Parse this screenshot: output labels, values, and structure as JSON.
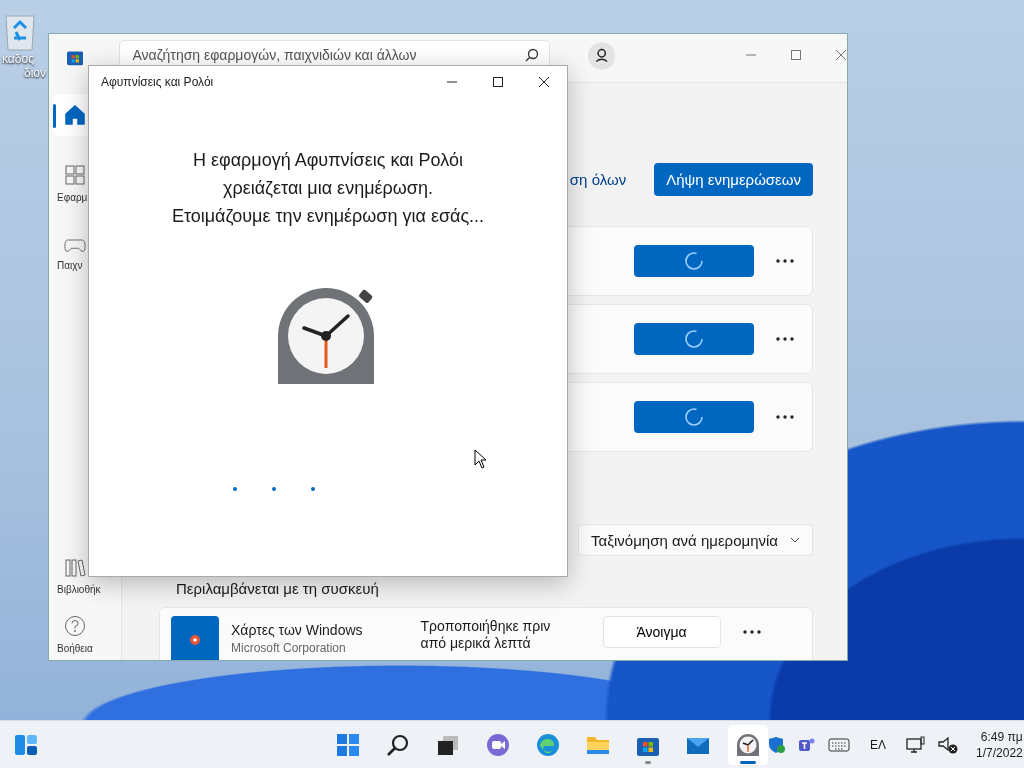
{
  "desktop": {
    "icons": [
      {
        "kind": "recycle-bin",
        "label_lines": [
          "καδος",
          "διον"
        ]
      }
    ]
  },
  "store": {
    "search": {
      "placeholder": "Αναζήτηση εφαρμογών, παιχνιδιών και άλλων"
    },
    "sidebar": {
      "top_items": [
        {
          "kind": "home",
          "selected": true
        },
        {
          "kind": "apps",
          "label": "Εφαρμ",
          "selected": false
        },
        {
          "kind": "games",
          "label": "Παιχν",
          "selected": false
        }
      ],
      "bottom_items": [
        {
          "kind": "library",
          "label": "Βιβλιοθήκ",
          "selected": false
        },
        {
          "kind": "help",
          "label": "Βοήθεια",
          "selected": false
        }
      ]
    },
    "updates": {
      "link": "ση όλων",
      "button": "Λήψη ενημερώσεων",
      "rows": [
        {
          "busy": true
        },
        {
          "busy": true
        },
        {
          "busy": true
        }
      ]
    },
    "sort": "Ταξινόμηση ανά ημερομηνία",
    "section_title": "Περιλαμβάνεται με τη συσκευή",
    "apps": [
      {
        "name": "Χάρτες των Windows",
        "publisher": "Microsoft Corporation",
        "modified": "Τροποποιήθηκε πριν από μερικά λεπτά",
        "button": "Άνοιγμα"
      }
    ]
  },
  "dialog": {
    "title": "Αφυπνίσεις και Ρολόι",
    "message_lines": [
      "Η εφαρμογή Αφυπνίσεις και Ρολόι",
      "χρειάζεται μια ενημέρωση.",
      "Ετοιμάζουμε την ενημέρωση για εσάς..."
    ]
  },
  "taskbar": {
    "items": [
      {
        "kind": "widgets",
        "running": false,
        "active": false
      },
      {
        "kind": "start",
        "running": false,
        "active": false
      },
      {
        "kind": "search",
        "running": false,
        "active": false
      },
      {
        "kind": "task-view",
        "running": false,
        "active": false
      },
      {
        "kind": "chat",
        "running": false,
        "active": false
      },
      {
        "kind": "edge",
        "running": false,
        "active": false
      },
      {
        "kind": "explorer",
        "running": false,
        "active": false
      },
      {
        "kind": "store",
        "running": true,
        "active": false
      },
      {
        "kind": "mail",
        "running": false,
        "active": false
      },
      {
        "kind": "clock",
        "running": true,
        "active": true
      }
    ],
    "tray": {
      "icons": [
        {
          "kind": "security"
        },
        {
          "kind": "teams"
        },
        {
          "kind": "keyboard"
        }
      ],
      "language": "ΕΛ",
      "status_icons": [
        {
          "kind": "network"
        },
        {
          "kind": "volume-muted"
        }
      ],
      "time": "6:49 πμ",
      "date": "1/7/2022"
    }
  }
}
